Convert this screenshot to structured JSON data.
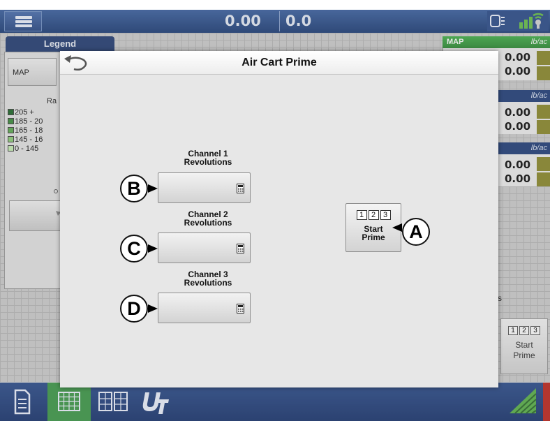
{
  "topbar": {
    "value1": "0.00",
    "value2": "0.0"
  },
  "legend": {
    "tab_label": "Legend",
    "map_button": "MAP",
    "rate_heading": "Ra",
    "items": [
      {
        "label": "205 +",
        "color": "#1f6b2a"
      },
      {
        "label": "185 - 20",
        "color": "#3e8f3e"
      },
      {
        "label": "165 - 18",
        "color": "#5fae52"
      },
      {
        "label": "145 - 16",
        "color": "#8fd07a"
      },
      {
        "label": "0 - 145",
        "color": "#c9f0b6"
      }
    ]
  },
  "right_panels": [
    {
      "header_left": "MAP",
      "header_right": "lb/ac",
      "values": [
        "0.00",
        "0.00"
      ]
    },
    {
      "header_left": "",
      "header_right": "lb/ac",
      "values": [
        "0.00",
        "0.00"
      ]
    },
    {
      "header_left": "",
      "header_right": "lb/ac",
      "values": [
        "0.00",
        "0.00"
      ]
    }
  ],
  "right_partial_text": "s",
  "background_start_prime": {
    "nums": [
      "1",
      "2",
      "3"
    ],
    "line1": "Start",
    "line2": "Prime"
  },
  "modal": {
    "title": "Air Cart Prime",
    "channels": [
      {
        "line1": "Channel 1",
        "line2": "Revolutions",
        "callout": "B"
      },
      {
        "line1": "Channel 2",
        "line2": "Revolutions",
        "callout": "C"
      },
      {
        "line1": "Channel 3",
        "line2": "Revolutions",
        "callout": "D"
      }
    ],
    "start_prime": {
      "nums": [
        "1",
        "2",
        "3"
      ],
      "line1": "Start",
      "line2": "Prime",
      "callout": "A"
    }
  },
  "colors": {
    "accent_blue": "#23407a",
    "active_green": "#3f9a4a",
    "map_header_green": "#3aa044"
  },
  "icons": [
    "menu-icon",
    "display-icon",
    "gps-signal-icon",
    "undo-icon",
    "back-arrow-icon",
    "calculator-icon",
    "notes-icon",
    "grid-view-icon",
    "split-view-icon",
    "ut-icon",
    "field-icon"
  ]
}
